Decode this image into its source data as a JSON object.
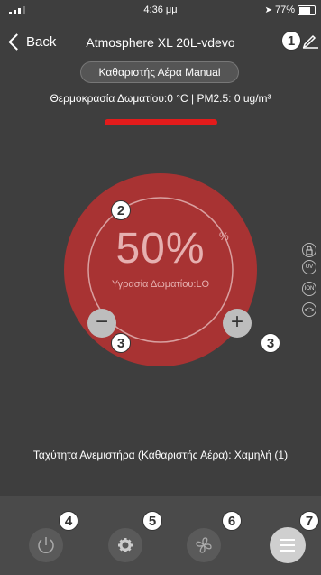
{
  "status": {
    "time": "4:36 μμ",
    "battery": "77%"
  },
  "header": {
    "back_label": "Back",
    "title": "Atmosphere XL 20L-vdevo"
  },
  "mode": {
    "label": "Καθαριστής Αέρα Manual"
  },
  "info": {
    "text": "Θερμοκρασία Δωματίου:0 °C   |  PM2.5: 0 ug/m³"
  },
  "dial": {
    "percent": "50%",
    "percent_sign": "%",
    "humidity_label": "Υγρασία Δωματίου:LO",
    "level": 0.5
  },
  "side_icons": [
    {
      "label": "lock"
    },
    {
      "label": "UV"
    },
    {
      "label": "ION"
    },
    {
      "label": "<>"
    }
  ],
  "fan_speed": {
    "text": "Ταχύτητα Ανεμιστήρα (Καθαριστής Αέρα): Χαμηλή (1)"
  },
  "badges": {
    "b1": "1",
    "b2": "2",
    "b3": "3",
    "b4": "4",
    "b5": "5",
    "b6": "6",
    "b7": "7"
  },
  "colors": {
    "accent": "#e31b1b",
    "dial": "#a83333",
    "background": "#3e3e3e"
  }
}
